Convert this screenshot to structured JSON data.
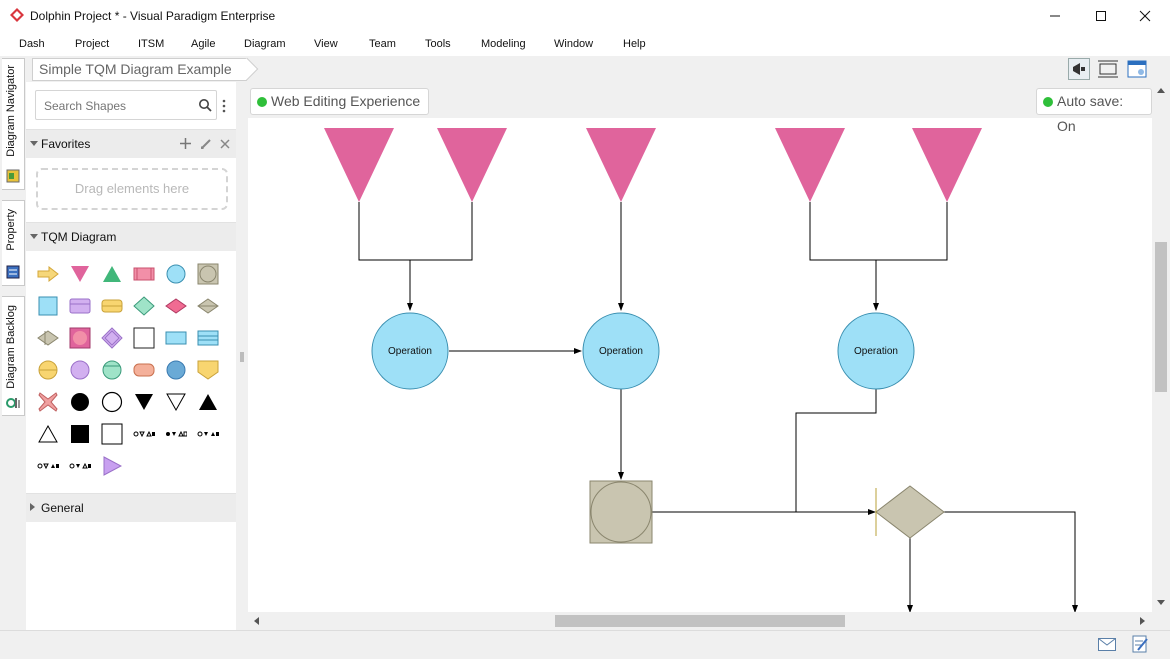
{
  "window": {
    "title": "Dolphin Project * - Visual Paradigm Enterprise",
    "controls": [
      "minimize",
      "maximize",
      "close"
    ]
  },
  "menu": [
    "Dash",
    "Project",
    "ITSM",
    "Agile",
    "Diagram",
    "View",
    "Team",
    "Tools",
    "Modeling",
    "Window",
    "Help"
  ],
  "side_tabs": [
    "Diagram Navigator",
    "Property",
    "Diagram Backlog"
  ],
  "breadcrumb": {
    "diagram_name": "Simple TQM Diagram Example"
  },
  "left_panel": {
    "search_placeholder": "Search Shapes",
    "favorites": {
      "label": "Favorites",
      "dropzone": "Drag elements here"
    },
    "tqm": {
      "label": "TQM Diagram"
    },
    "general": {
      "label": "General"
    }
  },
  "canvas": {
    "web_editing": "Web Editing Experience",
    "auto_save": "Auto save: On",
    "nodes": {
      "operation_1": "Operation",
      "operation_2": "Operation",
      "operation_3": "Operation"
    }
  },
  "colors": {
    "inventory_pink": "#e0649c",
    "operation_blue": "#9ee0f7",
    "inspection_gray": "#c9c5b0",
    "status_green": "#2fbf3a"
  }
}
